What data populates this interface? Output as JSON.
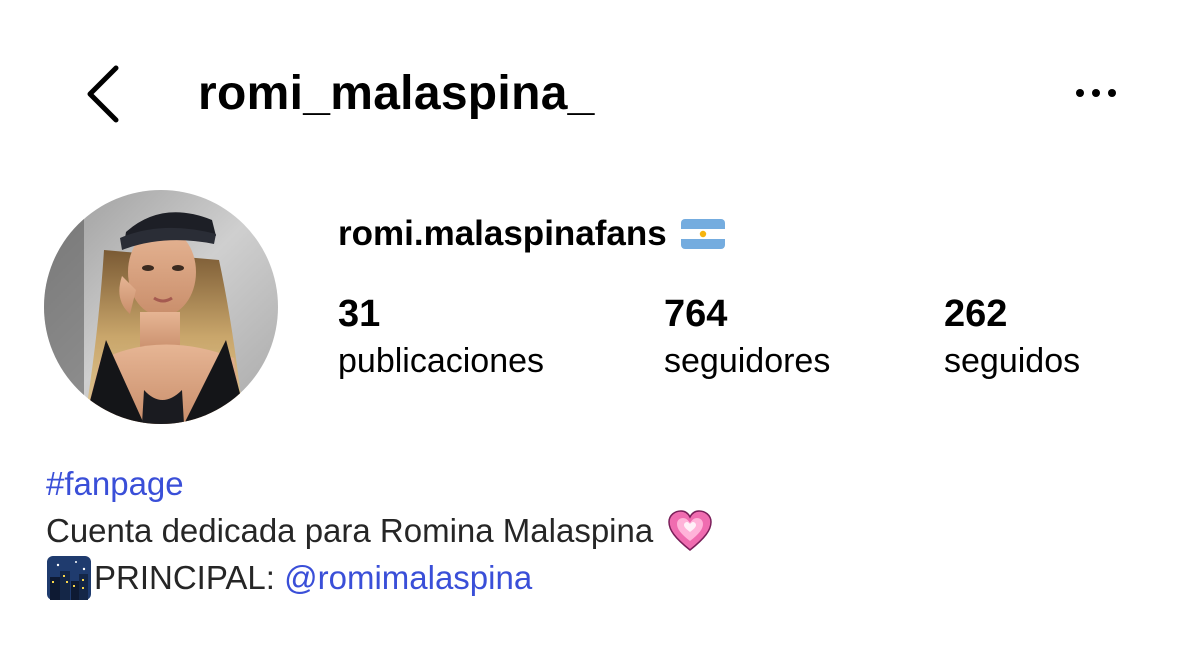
{
  "header": {
    "title": "romi_malaspina_",
    "back_icon": "chevron-left-icon",
    "more_icon": "ellipsis-horizontal-icon"
  },
  "profile": {
    "name": "romi.malaspinafans",
    "name_emoji": "argentina-flag-icon",
    "avatar": "profile-photo"
  },
  "stats": [
    {
      "count": "31",
      "label": "publicaciones"
    },
    {
      "count": "764",
      "label": "seguidores"
    },
    {
      "count": "262",
      "label": "seguidos"
    }
  ],
  "bio": {
    "hashtag": "#fanpage",
    "line2": "Cuenta dedicada para Romina Malaspina",
    "line2_emoji": "growing-heart-icon",
    "line3_prefix": "PRINCIPAL: ",
    "line3_emoji": "night-city-icon",
    "mention": "@romimalaspina"
  },
  "colors": {
    "link": "#3a4fd8",
    "text": "#262626",
    "background": "#ffffff"
  }
}
